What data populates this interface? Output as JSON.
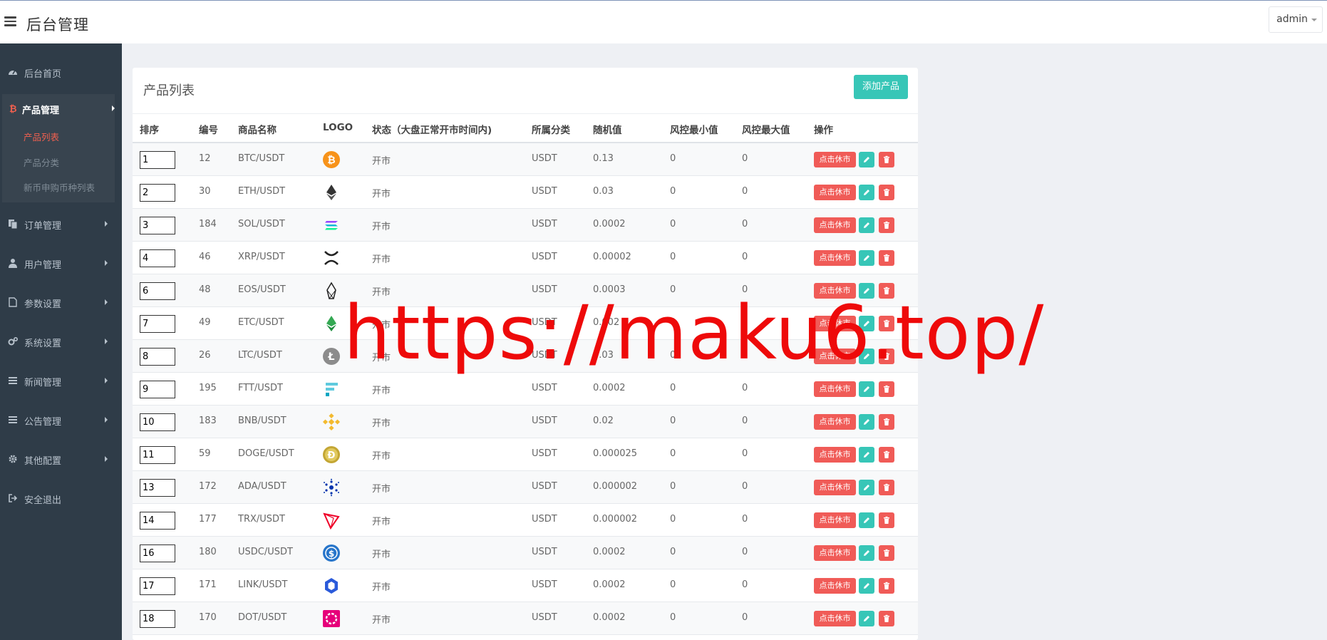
{
  "header": {
    "title": "后台管理",
    "user": "admin"
  },
  "sidebar": {
    "items": [
      {
        "label": "后台首页",
        "icon": "dashboard-icon"
      },
      {
        "label": "产品管理",
        "icon": "bitcoin-icon"
      },
      {
        "label": "订单管理",
        "icon": "copy-icon"
      },
      {
        "label": "用户管理",
        "icon": "user-icon"
      },
      {
        "label": "参数设置",
        "icon": "file-icon"
      },
      {
        "label": "系统设置",
        "icon": "cogs-icon"
      },
      {
        "label": "新闻管理",
        "icon": "list-icon"
      },
      {
        "label": "公告管理",
        "icon": "list-icon"
      },
      {
        "label": "其他配置",
        "icon": "gear-icon"
      },
      {
        "label": "安全退出",
        "icon": "sign-out-icon"
      }
    ],
    "sub_items": [
      {
        "label": "产品列表",
        "active": true
      },
      {
        "label": "产品分类",
        "active": false
      },
      {
        "label": "新币申购币种列表",
        "active": false
      }
    ]
  },
  "main": {
    "title": "产品列表",
    "add_button": "添加产品",
    "columns": [
      "排序",
      "编号",
      "商品名称",
      "LOGO",
      "状态（大盘正常开市时间内)",
      "所属分类",
      "随机值",
      "风控最小值",
      "风控最大值",
      "操作"
    ],
    "rest_label": "点击休市",
    "rows": [
      {
        "sort": "1",
        "id": "12",
        "name": "BTC/USDT",
        "logo": "btc",
        "status": "开市",
        "category": "USDT",
        "random": "0.13",
        "min": "0",
        "max": "0"
      },
      {
        "sort": "2",
        "id": "30",
        "name": "ETH/USDT",
        "logo": "eth",
        "status": "开市",
        "category": "USDT",
        "random": "0.03",
        "min": "0",
        "max": "0"
      },
      {
        "sort": "3",
        "id": "184",
        "name": "SOL/USDT",
        "logo": "sol",
        "status": "开市",
        "category": "USDT",
        "random": "0.0002",
        "min": "0",
        "max": "0"
      },
      {
        "sort": "4",
        "id": "46",
        "name": "XRP/USDT",
        "logo": "xrp",
        "status": "开市",
        "category": "USDT",
        "random": "0.00002",
        "min": "0",
        "max": "0"
      },
      {
        "sort": "6",
        "id": "48",
        "name": "EOS/USDT",
        "logo": "eos",
        "status": "开市",
        "category": "USDT",
        "random": "0.0003",
        "min": "0",
        "max": "0"
      },
      {
        "sort": "7",
        "id": "49",
        "name": "ETC/USDT",
        "logo": "etc",
        "status": "开市",
        "category": "USDT",
        "random": "0.002",
        "min": "0",
        "max": "0"
      },
      {
        "sort": "8",
        "id": "26",
        "name": "LTC/USDT",
        "logo": "ltc",
        "status": "开市",
        "category": "USDT",
        "random": "0.03",
        "min": "0",
        "max": "0"
      },
      {
        "sort": "9",
        "id": "195",
        "name": "FTT/USDT",
        "logo": "ftt",
        "status": "开市",
        "category": "USDT",
        "random": "0.0002",
        "min": "0",
        "max": "0"
      },
      {
        "sort": "10",
        "id": "183",
        "name": "BNB/USDT",
        "logo": "bnb",
        "status": "开市",
        "category": "USDT",
        "random": "0.02",
        "min": "0",
        "max": "0"
      },
      {
        "sort": "11",
        "id": "59",
        "name": "DOGE/USDT",
        "logo": "doge",
        "status": "开市",
        "category": "USDT",
        "random": "0.000025",
        "min": "0",
        "max": "0"
      },
      {
        "sort": "13",
        "id": "172",
        "name": "ADA/USDT",
        "logo": "ada",
        "status": "开市",
        "category": "USDT",
        "random": "0.000002",
        "min": "0",
        "max": "0"
      },
      {
        "sort": "14",
        "id": "177",
        "name": "TRX/USDT",
        "logo": "trx",
        "status": "开市",
        "category": "USDT",
        "random": "0.000002",
        "min": "0",
        "max": "0"
      },
      {
        "sort": "16",
        "id": "180",
        "name": "USDC/USDT",
        "logo": "usdc",
        "status": "开市",
        "category": "USDT",
        "random": "0.0002",
        "min": "0",
        "max": "0"
      },
      {
        "sort": "17",
        "id": "171",
        "name": "LINK/USDT",
        "logo": "link",
        "status": "开市",
        "category": "USDT",
        "random": "0.0002",
        "min": "0",
        "max": "0"
      },
      {
        "sort": "18",
        "id": "170",
        "name": "DOT/USDT",
        "logo": "dot",
        "status": "开市",
        "category": "USDT",
        "random": "0.0002",
        "min": "0",
        "max": "0"
      }
    ]
  },
  "watermark": "https://maku6.top/",
  "colors": {
    "accent": "#37c6b7",
    "danger": "#f05b57",
    "sidebar": "#2f3c48",
    "active_sub": "#f2604f",
    "watermark": "#ee0a0a"
  }
}
